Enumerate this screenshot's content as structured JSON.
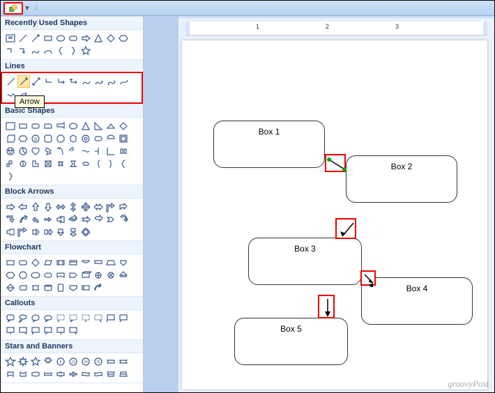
{
  "categories": {
    "recent": "Recently Used Shapes",
    "lines": "Lines",
    "basic": "Basic Shapes",
    "block": "Block Arrows",
    "flow": "Flowchart",
    "call": "Callouts",
    "stars": "Stars and Banners"
  },
  "tooltip": "Arrow",
  "ruler": {
    "t0": "",
    "t1": "1",
    "t2": "2",
    "t3": "3"
  },
  "boxes": {
    "b1": "Box 1",
    "b2": "Box 2",
    "b3": "Box 3",
    "b4": "Box 4",
    "b5": "Box 5"
  },
  "watermark": "groovyPost",
  "icon_names": {
    "qat": "shapes-dropdown"
  }
}
